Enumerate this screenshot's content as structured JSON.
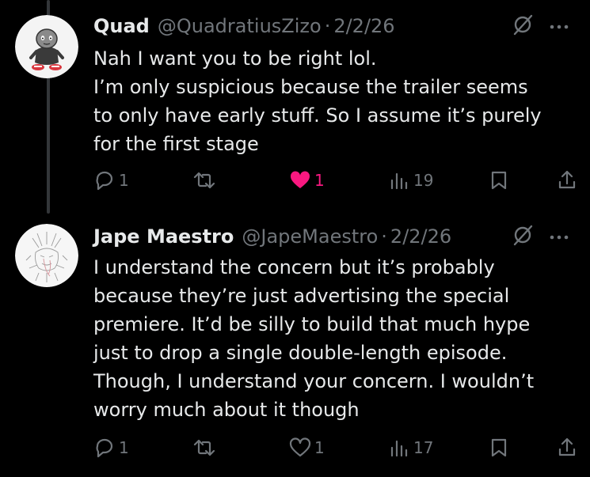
{
  "colors": {
    "background": "#000000",
    "text": "#e7e9ea",
    "muted": "#71767b",
    "like_active": "#f91880",
    "thread_line": "#333639"
  },
  "posts": [
    {
      "author": {
        "name": "Quad",
        "handle": "@QuadratiusZizo",
        "avatar_icon": "cartoon-character-avatar"
      },
      "separator": "·",
      "date": "2/2/26",
      "lines": [
        "Nah I want you to be right lol.",
        "I’m only suspicious because the trailer seems",
        "to only have early stuff. So I assume it’s purely",
        "for the first stage"
      ],
      "stats": {
        "replies": "1",
        "reposts": "",
        "likes": "1",
        "liked": true,
        "views": "19"
      },
      "icons": [
        "grok-icon",
        "more-icon",
        "reply-icon",
        "repost-icon",
        "like-icon",
        "views-icon",
        "bookmark-icon",
        "share-icon"
      ]
    },
    {
      "author": {
        "name": "Jape Maestro",
        "handle": "@JapeMaestro",
        "avatar_icon": "sketch-drawing-avatar"
      },
      "separator": "·",
      "date": "2/2/26",
      "lines": [
        "I understand the concern but it’s probably",
        "because they’re just advertising the special",
        "premiere. It’d be silly to build that much hype",
        "just to drop a single double-length episode.",
        "Though, I understand your concern. I wouldn’t",
        "worry much about it though"
      ],
      "stats": {
        "replies": "1",
        "reposts": "",
        "likes": "1",
        "liked": false,
        "views": "17"
      },
      "icons": [
        "grok-icon",
        "more-icon",
        "reply-icon",
        "repost-icon",
        "like-icon",
        "views-icon",
        "bookmark-icon",
        "share-icon"
      ]
    }
  ]
}
